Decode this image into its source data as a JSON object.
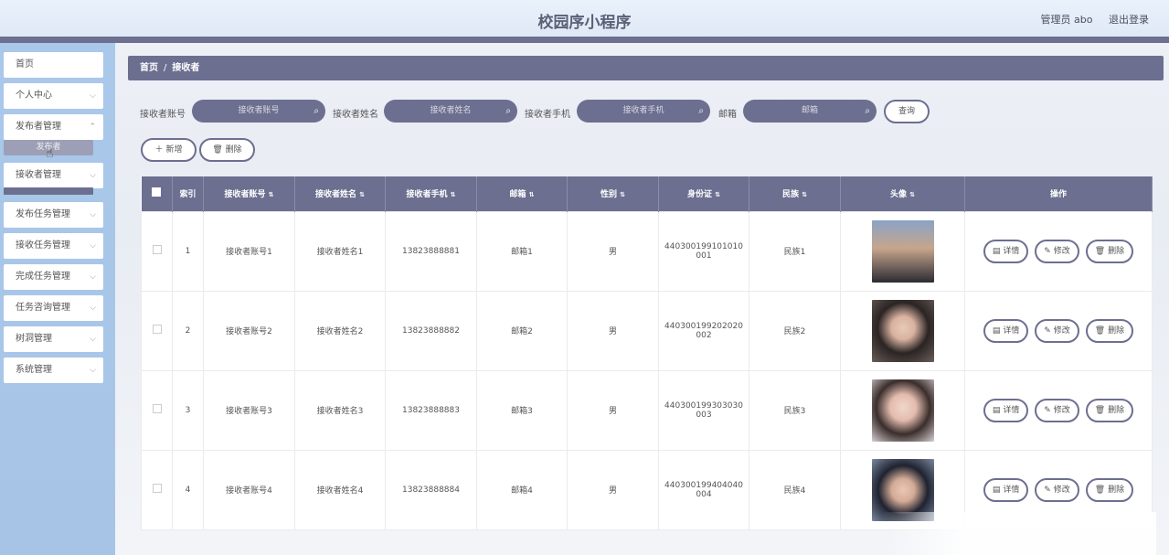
{
  "header": {
    "title": "校园序小程序",
    "user_label": "管理员 abo",
    "logout_label": "退出登录"
  },
  "sidebar": {
    "items": [
      {
        "label": "首页"
      },
      {
        "label": "个人中心"
      },
      {
        "label": "发布者管理"
      },
      {
        "label": "接收者管理"
      },
      {
        "label": "发布任务管理"
      },
      {
        "label": "接收任务管理"
      },
      {
        "label": "完成任务管理"
      },
      {
        "label": "任务咨询管理"
      },
      {
        "label": "树洞管理"
      },
      {
        "label": "系统管理"
      }
    ],
    "sub_item_label": "发布者"
  },
  "breadcrumb": {
    "home": "首页",
    "separator": "/",
    "current": "接收者"
  },
  "search": {
    "account_label": "接收者账号",
    "account_placeholder": "接收者账号",
    "name_label": "接收者姓名",
    "name_placeholder": "接收者姓名",
    "phone_label": "接收者手机",
    "phone_placeholder": "接收者手机",
    "email_label": "邮箱",
    "email_placeholder": "邮箱",
    "query_label": "查询"
  },
  "toolbar": {
    "add_label": "新增",
    "delete_label": "删除"
  },
  "table": {
    "headers": [
      "索引",
      "接收者账号",
      "接收者姓名",
      "接收者手机",
      "邮箱",
      "性别",
      "身份证",
      "民族",
      "头像",
      "操作"
    ],
    "rows": [
      {
        "index": "1",
        "account": "接收者账号1",
        "name": "接收者姓名1",
        "phone": "13823888881",
        "email": "邮箱1",
        "gender": "男",
        "id_card": "440300199101010001",
        "ethnic": "民族1"
      },
      {
        "index": "2",
        "account": "接收者账号2",
        "name": "接收者姓名2",
        "phone": "13823888882",
        "email": "邮箱2",
        "gender": "男",
        "id_card": "440300199202020002",
        "ethnic": "民族2"
      },
      {
        "index": "3",
        "account": "接收者账号3",
        "name": "接收者姓名3",
        "phone": "13823888883",
        "email": "邮箱3",
        "gender": "男",
        "id_card": "440300199303030003",
        "ethnic": "民族3"
      },
      {
        "index": "4",
        "account": "接收者账号4",
        "name": "接收者姓名4",
        "phone": "13823888884",
        "email": "邮箱4",
        "gender": "男",
        "id_card": "440300199404040004",
        "ethnic": "民族4"
      }
    ],
    "actions": {
      "detail": "详情",
      "edit": "修改",
      "delete": "删除"
    }
  },
  "colors": {
    "accent": "#6c6f90",
    "sidebar_bg": "#a9c8ea"
  }
}
